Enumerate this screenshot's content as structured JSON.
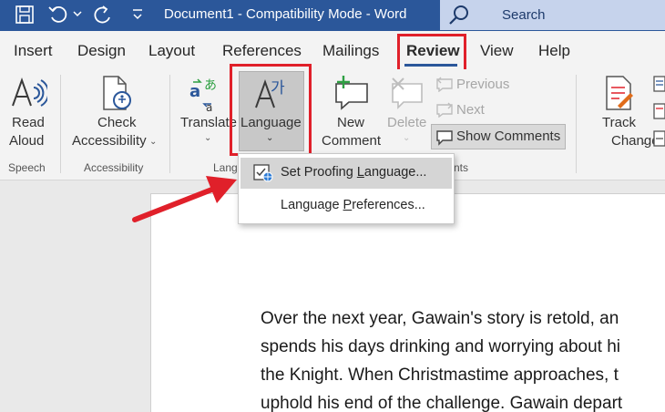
{
  "titlebar": {
    "title": "Document1  -  Compatibility Mode  -  Word",
    "search_label": "Search"
  },
  "tabs": [
    {
      "label": "Insert"
    },
    {
      "label": "Design"
    },
    {
      "label": "Layout"
    },
    {
      "label": "References"
    },
    {
      "label": "Mailings"
    },
    {
      "label": "Review",
      "active": true
    },
    {
      "label": "View"
    },
    {
      "label": "Help"
    }
  ],
  "ribbon": {
    "read_aloud": {
      "line1": "Read",
      "line2": "Aloud"
    },
    "check_accessibility": {
      "line1": "Check",
      "line2": "Accessibility"
    },
    "translate": {
      "label": "Translate"
    },
    "language": {
      "label": "Language"
    },
    "new_comment": {
      "line1": "New",
      "line2": "Comment"
    },
    "delete": {
      "label": "Delete"
    },
    "previous": {
      "label": "Previous"
    },
    "next": {
      "label": "Next"
    },
    "show_comments": {
      "label": "Show Comments"
    },
    "track_changes": {
      "line1": "Track",
      "line2": "Changes"
    },
    "groups": {
      "speech": "Speech",
      "accessibility": "Accessibility",
      "language": "Lang",
      "comments": "nts"
    }
  },
  "dropdown": {
    "items": [
      {
        "label": "Set Proofing Language...",
        "accel": "L"
      },
      {
        "label": "Language Preferences...",
        "accel": "P"
      }
    ]
  },
  "document": {
    "lines": [
      "Over the next year, Gawain's story is retold, an",
      "spends his days drinking and worrying about hi",
      "the Knight. When Christmastime approaches, t",
      "uphold his end of the challenge. Gawain depart"
    ]
  },
  "colors": {
    "title_bar": "#2b579a",
    "highlight": "#e0202a",
    "accent": "#2b579a"
  }
}
